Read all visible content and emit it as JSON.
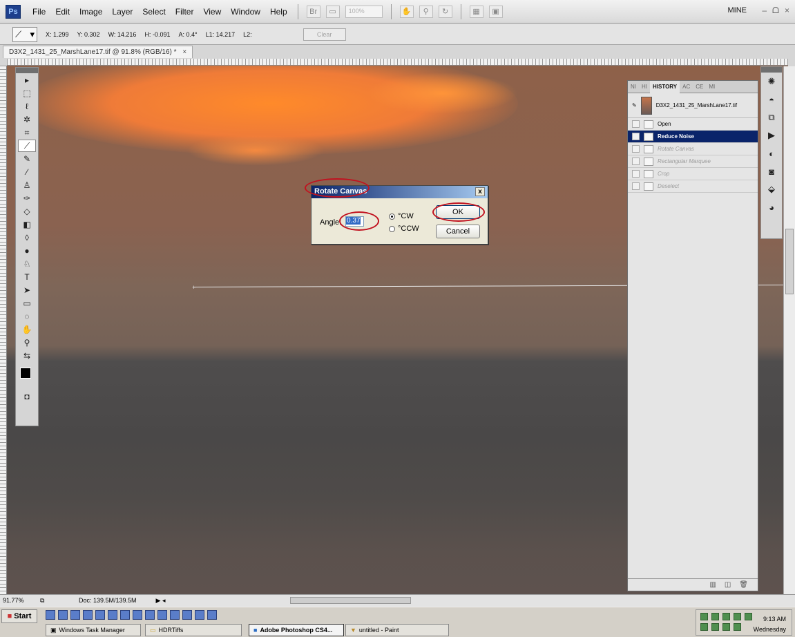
{
  "menubar": {
    "logo": "Ps",
    "items": [
      "File",
      "Edit",
      "Image",
      "Layer",
      "Select",
      "Filter",
      "View",
      "Window",
      "Help"
    ],
    "zoom_value": "100%",
    "workspace": "MINE",
    "window_controls": [
      "–",
      "ᗝ",
      "×"
    ]
  },
  "options": {
    "x": "X: 1.299",
    "y": "Y: 0.302",
    "w": "W: 14.216",
    "h": "H: -0.091",
    "a": "A: 0.4°",
    "l1": "L1: 14.217",
    "l2": "L2:",
    "clear": "Clear"
  },
  "document": {
    "tab_title": "D3X2_1431_25_MarshLane17.tif @ 91.8% (RGB/16) *",
    "close": "×"
  },
  "dialog": {
    "title": "Rotate Canvas",
    "angle_label": "Angle:",
    "angle_value": "0.37",
    "cw_label": "°CW",
    "ccw_label": "°CCW",
    "ok_label": "OK",
    "cancel_label": "Cancel",
    "close": "x"
  },
  "history": {
    "tabs": [
      "NI",
      "HI",
      "HISTORY",
      "AC",
      "CE",
      "MI"
    ],
    "snapshot_name": "D3X2_1431_25_MarshLane17.tif",
    "items": [
      {
        "label": "Open",
        "state": "normal"
      },
      {
        "label": "Reduce Noise",
        "state": "selected"
      },
      {
        "label": "Rotate Canvas",
        "state": "dim"
      },
      {
        "label": "Rectangular Marquee",
        "state": "dim"
      },
      {
        "label": "Crop",
        "state": "dim"
      },
      {
        "label": "Deselect",
        "state": "dim"
      }
    ]
  },
  "status": {
    "zoom": "91.77%",
    "doc": "Doc: 139.5M/139.5M"
  },
  "taskbar": {
    "start": "Start",
    "tasks": [
      "Windows Task Manager",
      "HDRTiffs",
      "Adobe Photoshop CS4...",
      "untitled - Paint"
    ],
    "time": "9:13 AM",
    "day": "Wednesday"
  }
}
